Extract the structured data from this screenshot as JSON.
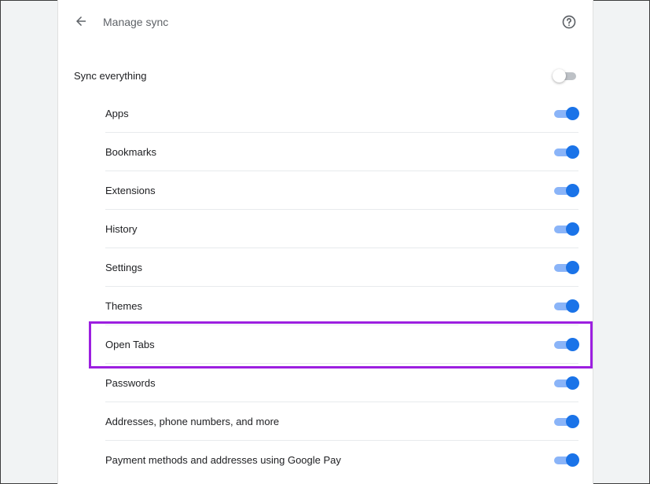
{
  "header": {
    "title": "Manage sync"
  },
  "main_toggle": {
    "label": "Sync everything",
    "on": false
  },
  "items": [
    {
      "label": "Apps",
      "on": true
    },
    {
      "label": "Bookmarks",
      "on": true
    },
    {
      "label": "Extensions",
      "on": true
    },
    {
      "label": "History",
      "on": true
    },
    {
      "label": "Settings",
      "on": true
    },
    {
      "label": "Themes",
      "on": true
    },
    {
      "label": "Open Tabs",
      "on": true
    },
    {
      "label": "Passwords",
      "on": true
    },
    {
      "label": "Addresses, phone numbers, and more",
      "on": true
    },
    {
      "label": "Payment methods and addresses using Google Pay",
      "on": true
    }
  ],
  "highlighted_item": "Open Tabs",
  "colors": {
    "accent": "#1a73e8",
    "track_on": "#8ab4f8",
    "highlight": "#9c1fe0"
  }
}
